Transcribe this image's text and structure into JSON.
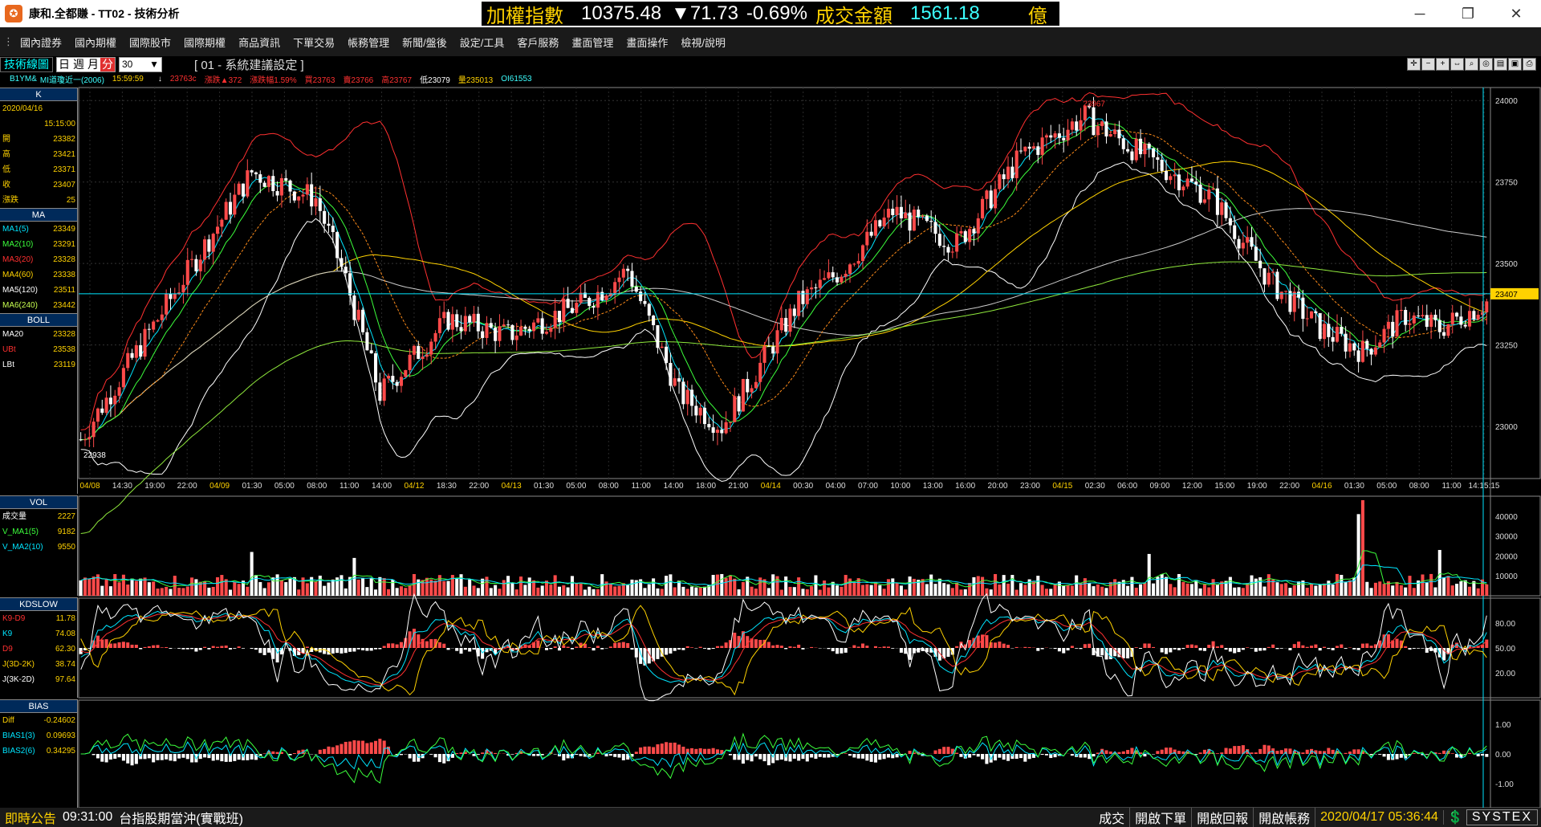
{
  "window": {
    "title": "康和.全都賺 - TT02 - 技術分析",
    "app_icon": "app-logo-icon",
    "buttons": [
      "minimize-icon",
      "maximize-icon",
      "close-icon"
    ]
  },
  "ticker": {
    "name": "加權指數",
    "value": "10375.48",
    "change": "▼71.73",
    "pct": "-0.69%",
    "turnover_label": "成交金額",
    "turnover": "1561.18",
    "unit": "億"
  },
  "menu": [
    "國內證券",
    "國內期權",
    "國際股市",
    "國際期權",
    "商品資訊",
    "下單交易",
    "帳務管理",
    "新聞/盤後",
    "設定/工具",
    "客戶服務",
    "畫面管理",
    "畫面操作",
    "檢視/說明"
  ],
  "toolbar": {
    "title": "技術線圖",
    "periods": [
      "日",
      "週",
      "月",
      "分"
    ],
    "selected_period": "分",
    "minutes": "30",
    "setting": "[ 01 - 系統建議設定 ]"
  },
  "quote": {
    "symbol": "B1YM&",
    "name": "MI道瓊近一(2006)",
    "time": "15:59:59",
    "last": "23763c",
    "change": "漲跌▲372",
    "pct": "漲跌幅1.59%",
    "bid": "買23763",
    "ask": "賣23766",
    "high": "高23767",
    "low": "低23079",
    "volume": "量235013",
    "oi": "OI61553"
  },
  "k_panel": {
    "header": "K",
    "date": "2020/04/16",
    "time": "15:15:00",
    "rows": [
      {
        "label": "開",
        "value": "23382"
      },
      {
        "label": "高",
        "value": "23421"
      },
      {
        "label": "低",
        "value": "23371"
      },
      {
        "label": "收",
        "value": "23407"
      },
      {
        "label": "漲跌",
        "value": "25"
      }
    ]
  },
  "ma_panel": {
    "header": "MA",
    "rows": [
      {
        "label": "MA1(5)",
        "value": "23349",
        "color": "#00e5ff"
      },
      {
        "label": "MA2(10)",
        "value": "23291",
        "color": "#3cff3c"
      },
      {
        "label": "MA3(20)",
        "value": "23328",
        "color": "#ff3030"
      },
      {
        "label": "MA4(60)",
        "value": "23338",
        "color": "#ffd200"
      },
      {
        "label": "MA5(120)",
        "value": "23511",
        "color": "#ffffff"
      },
      {
        "label": "MA6(240)",
        "value": "23442",
        "color": "#c8ff50"
      }
    ]
  },
  "boll_panel": {
    "header": "BOLL",
    "rows": [
      {
        "label": "MA20",
        "value": "23328",
        "color": "#ffffff"
      },
      {
        "label": "UBt",
        "value": "23538",
        "color": "#ff3030"
      },
      {
        "label": "LBt",
        "value": "23119",
        "color": "#ffffff"
      }
    ]
  },
  "vol_panel": {
    "header": "VOL",
    "rows": [
      {
        "label": "成交量",
        "value": "2227",
        "color": "#ffffff"
      },
      {
        "label": "V_MA1(5)",
        "value": "9182",
        "color": "#3cff3c"
      },
      {
        "label": "V_MA2(10)",
        "value": "9550",
        "color": "#00e5ff"
      }
    ]
  },
  "kd_panel": {
    "header": "KDSLOW",
    "rows": [
      {
        "label": "K9-D9",
        "value": "11.78",
        "color": "#ff3030"
      },
      {
        "label": "K9",
        "value": "74.08",
        "color": "#00e5ff"
      },
      {
        "label": "D9",
        "value": "62.30",
        "color": "#ff3030"
      },
      {
        "label": "J(3D-2K)",
        "value": "38.74",
        "color": "#ffd200"
      },
      {
        "label": "J(3K-2D)",
        "value": "97.64",
        "color": "#ffffff"
      }
    ]
  },
  "bias_panel": {
    "header": "BIAS",
    "rows": [
      {
        "label": "Diff",
        "value": "-0.24602",
        "color": "#ffd200"
      },
      {
        "label": "BIAS1(3)",
        "value": "0.09693",
        "color": "#00e5ff"
      },
      {
        "label": "BIAS2(6)",
        "value": "0.34295",
        "color": "#00e5ff"
      }
    ]
  },
  "chart_data": {
    "type": "candlestick",
    "price_axis": {
      "ticks": [
        23000,
        23250,
        23500,
        23750,
        24000
      ],
      "range": [
        22840,
        24040
      ],
      "current": "23407"
    },
    "volume_axis": {
      "ticks": [
        10000,
        20000,
        30000,
        40000
      ],
      "range": [
        0,
        50000
      ]
    },
    "kd_axis": {
      "ticks": [
        20.0,
        50.0,
        80.0
      ],
      "labels": [
        "20.00",
        "50.00",
        "80.00"
      ],
      "range": [
        -10,
        110
      ]
    },
    "bias_axis": {
      "ticks": [
        1.0,
        0.0,
        -1.0
      ],
      "labels": [
        "1.00",
        "0.00",
        "-1.00"
      ],
      "range": [
        -1.8,
        1.8
      ]
    },
    "annotations": [
      {
        "label": "23967",
        "value": 23967
      },
      {
        "label": "22938",
        "value": 22938
      }
    ],
    "time_labels": [
      "04/08",
      "14:30",
      "19:00",
      "22:00",
      "04/09",
      "01:30",
      "05:00",
      "08:00",
      "11:00",
      "14:00",
      "04/12",
      "18:30",
      "22:00",
      "04/13",
      "01:30",
      "05:00",
      "08:00",
      "11:00",
      "14:00",
      "18:00",
      "21:00",
      "04/14",
      "00:30",
      "04:00",
      "07:00",
      "10:00",
      "13:00",
      "16:00",
      "20:00",
      "23:00",
      "04/15",
      "02:30",
      "06:00",
      "09:00",
      "12:00",
      "15:00",
      "19:00",
      "22:00",
      "04/16",
      "01:30",
      "05:00",
      "08:00",
      "11:00",
      "14:15:15"
    ],
    "series_colors": {
      "up": "#ff4a4a",
      "down": "#ffffff",
      "boll_upper": "#ff3030",
      "boll_lower": "#ffffff",
      "ma60": "#ffd200",
      "ma120": "#cccccc",
      "ma240": "#8fe83c"
    }
  },
  "status": {
    "news_label": "即時公告",
    "news_time": "09:31:00",
    "news_text": "台指股期當沖(實戰班)",
    "items": [
      "成交",
      "開啟下單",
      "開啟回報",
      "開啟帳務"
    ],
    "datetime": "2020/04/17 05:36:44",
    "brand": "SYSTEX"
  }
}
